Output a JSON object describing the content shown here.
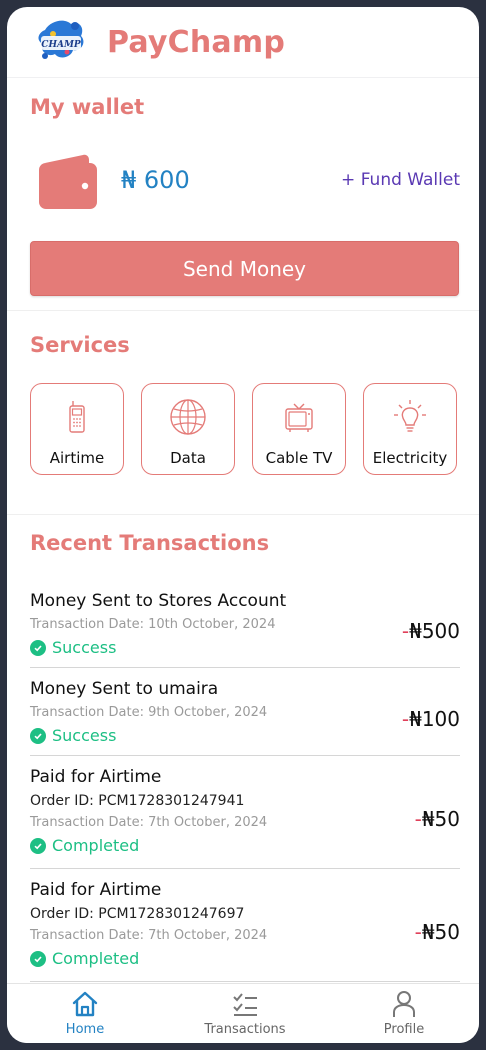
{
  "header": {
    "app_name": "PayChamp",
    "logo_text": "CHAMP"
  },
  "wallet": {
    "title": "My wallet",
    "balance": "₦ 600",
    "fund_label": "+ Fund Wallet",
    "send_label": "Send Money"
  },
  "services": {
    "title": "Services",
    "items": [
      {
        "label": "Airtime",
        "icon": "phone-icon"
      },
      {
        "label": "Data",
        "icon": "globe-icon"
      },
      {
        "label": "Cable TV",
        "icon": "tv-icon"
      },
      {
        "label": "Electricity",
        "icon": "bulb-icon"
      }
    ]
  },
  "recent": {
    "title": "Recent Transactions",
    "items": [
      {
        "title": "Money Sent to Stores Account",
        "date": "Transaction Date: 10th October, 2024",
        "status": "Success",
        "minus": "-",
        "amount": "₦500"
      },
      {
        "title": "Money Sent to umaira",
        "date": "Transaction Date: 9th October, 2024",
        "status": "Success",
        "minus": "-",
        "amount": "₦100"
      },
      {
        "title": "Paid for Airtime",
        "order": "Order ID: PCM1728301247941",
        "date": "Transaction Date: 7th October, 2024",
        "status": "Completed",
        "minus": "-",
        "amount": "₦50"
      },
      {
        "title": "Paid for Airtime",
        "order": "Order ID: PCM1728301247697",
        "date": "Transaction Date: 7th October, 2024",
        "status": "Completed",
        "minus": "-",
        "amount": "₦50"
      }
    ]
  },
  "nav": {
    "items": [
      {
        "label": "Home",
        "active": true
      },
      {
        "label": "Transactions",
        "active": false
      },
      {
        "label": "Profile",
        "active": false
      }
    ]
  },
  "colors": {
    "brand": "#e47b78",
    "balance": "#2382c3",
    "link": "#5a39b3",
    "success": "#1dbf84",
    "nav_active": "#2382c3"
  }
}
